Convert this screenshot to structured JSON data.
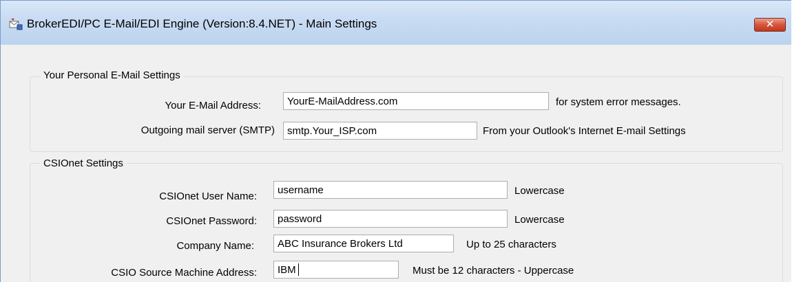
{
  "window": {
    "title": "BrokerEDI/PC E-Mail/EDI Engine (Version:8.4.NET)  - Main Settings",
    "close_label": "✕"
  },
  "email_group": {
    "title": "Your Personal E-Mail Settings",
    "email_label": "Your E-Mail Address:",
    "email_value": "YourE-MailAddress.com",
    "email_hint": "for system error messages.",
    "smtp_label": "Outgoing mail server (SMTP)",
    "smtp_value": "smtp.Your_ISP.com",
    "smtp_hint": "From your Outlook's Internet E-mail Settings"
  },
  "csio_group": {
    "title": "CSIOnet Settings",
    "user_label": "CSIOnet User Name:",
    "user_value": "username",
    "user_hint": "Lowercase",
    "password_label": "CSIOnet Password:",
    "password_value": "password",
    "password_hint": "Lowercase",
    "company_label": "Company Name:",
    "company_value": "ABC Insurance Brokers Ltd",
    "company_hint": "Up to 25 characters",
    "source_label": "CSIO Source Machine Address:",
    "source_value": "IBM",
    "source_hint": "Must be 12 characters - Uppercase"
  },
  "icons": {
    "app": "envelope-app-icon",
    "close": "close-icon"
  },
  "colors": {
    "close_button": "#c2371c",
    "titlebar": "#c9dcf3"
  }
}
